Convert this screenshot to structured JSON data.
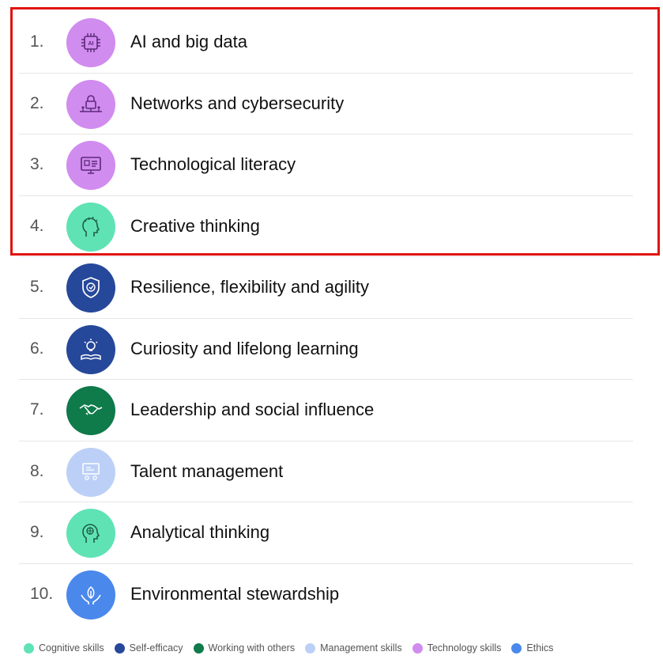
{
  "colors": {
    "cognitive": "#5fe3b5",
    "self_efficacy": "#26489a",
    "working_with_others": "#0f7a4a",
    "management": "#bcd0f7",
    "technology": "#d18cef",
    "ethics": "#4a88ec",
    "highlight": "#e0140f"
  },
  "skills": [
    {
      "rank": "1.",
      "label": "AI and big data",
      "category": "technology",
      "icon": "ai-chip-icon"
    },
    {
      "rank": "2.",
      "label": "Networks and cybersecurity",
      "category": "technology",
      "icon": "network-lock-icon"
    },
    {
      "rank": "3.",
      "label": "Technological literacy",
      "category": "technology",
      "icon": "monitor-icon"
    },
    {
      "rank": "4.",
      "label": "Creative thinking",
      "category": "cognitive",
      "icon": "head-ideas-icon"
    },
    {
      "rank": "5.",
      "label": "Resilience, flexibility and agility",
      "category": "self_efficacy",
      "icon": "shield-check-icon"
    },
    {
      "rank": "6.",
      "label": "Curiosity and lifelong learning",
      "category": "self_efficacy",
      "icon": "book-lightbulb-icon"
    },
    {
      "rank": "7.",
      "label": "Leadership and social influence",
      "category": "working_with_others",
      "icon": "handshake-icon"
    },
    {
      "rank": "8.",
      "label": "Talent management",
      "category": "management",
      "icon": "people-board-icon"
    },
    {
      "rank": "9.",
      "label": "Analytical thinking",
      "category": "cognitive",
      "icon": "head-brain-icon"
    },
    {
      "rank": "10.",
      "label": "Environmental stewardship",
      "category": "ethics",
      "icon": "hands-leaf-icon"
    }
  ],
  "legend": [
    {
      "label": "Cognitive skills",
      "category": "cognitive"
    },
    {
      "label": "Self-efficacy",
      "category": "self_efficacy"
    },
    {
      "label": "Working with others",
      "category": "working_with_others"
    },
    {
      "label": "Management skills",
      "category": "management"
    },
    {
      "label": "Technology skills",
      "category": "technology"
    },
    {
      "label": "Ethics",
      "category": "ethics"
    }
  ]
}
